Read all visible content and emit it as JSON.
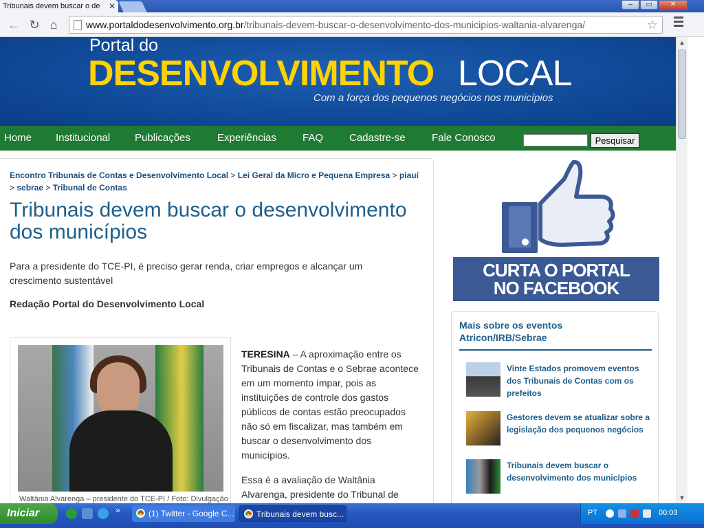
{
  "browser": {
    "tab_title": "Tribunais devem buscar o de",
    "tab_close": "✕",
    "url_domain": "www.portaldodesenvolvimento.org.br",
    "url_path": "/tribunais-devem-buscar-o-desenvolvimento-dos-municipios-waltania-alvarenga/",
    "win_min": "–",
    "win_max": "▭",
    "win_close": "✕",
    "back_icon": "←",
    "reload_icon": "↻",
    "home_icon": "⌂",
    "star_icon": "☆"
  },
  "banner": {
    "line1": "Portal do",
    "line2": "DESENVOLVIMENTO",
    "line3": "LOCAL",
    "tagline": "Com a força dos pequenos negócios nos municípios"
  },
  "nav": {
    "items": [
      "Home",
      "Institucional",
      "Publicações",
      "Experiências",
      "FAQ",
      "Cadastre-se",
      "Fale Conosco"
    ],
    "search_button": "Pesquisar",
    "search_value": ""
  },
  "article": {
    "breadcrumbs": [
      "Encontro Tribunais de Contas e Desenvolvimento Local",
      "Lei Geral da Micro e Pequena Empresa",
      "piauí",
      "sebrae",
      "Tribunal de Contas"
    ],
    "crumb_sep": ">",
    "title": "Tribunais devem buscar o desenvolvimento dos municípios",
    "lead": "Para a presidente do TCE-PI, é preciso gerar renda, criar empregos e alcançar um crescimento sustentável",
    "byline": "Redação Portal do Desenvolvimento Local",
    "photo_caption": "Waltânia Alvarenga – presidente do TCE-PI / Foto: Divulgação",
    "dateline": "TERESINA",
    "para1": " – A aproximação entre os Tribunais de Contas e o Sebrae acontece em um momento ímpar, pois as instituições de controle dos gastos públicos de contas estão preocupados não só em fiscalizar, mas também em buscar o desenvolvimento dos municípios.",
    "para2": "Essa é a avaliação de Waltânia Alvarenga, presidente do Tribunal de"
  },
  "sidebar": {
    "fb_line1": "CURTA O PORTAL",
    "fb_line2": "NO FACEBOOK",
    "related_title": "Mais sobre os eventos Atricon/IRB/Sebrae",
    "related": [
      "Vinte Estados promovem eventos dos Tribunais de Contas com os prefeitos",
      "Gestores devem se atualizar sobre a legislação dos pequenos negócios",
      "Tribunais devem buscar o desenvolvimento dos municípios"
    ]
  },
  "taskbar": {
    "start": "Iniciar",
    "more": "»",
    "windows": [
      "(1) Twitter - Google C...",
      "Tribunais devem busc..."
    ],
    "lang": "PT",
    "clock": "00:03"
  },
  "colors": {
    "banner_blue": "#104a98",
    "menu_green": "#1f7a33",
    "link_blue": "#1d5f8c",
    "facebook_blue": "#3b5a95"
  }
}
